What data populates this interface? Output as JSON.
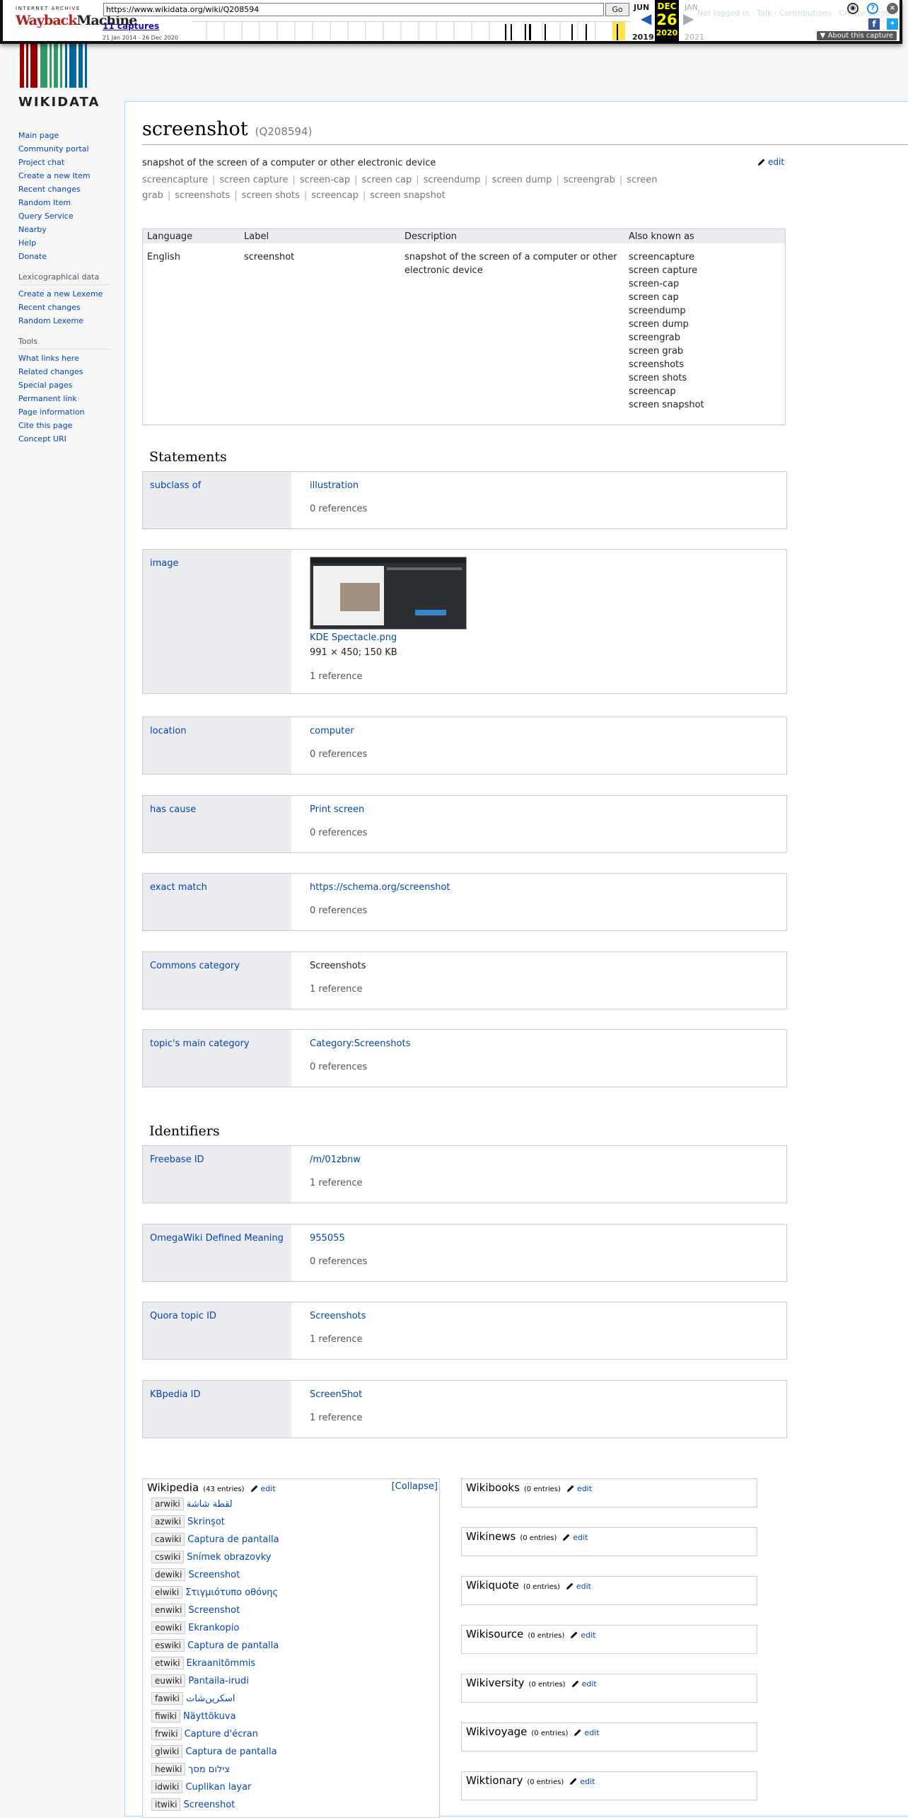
{
  "wayback": {
    "url": "https://www.wikidata.org/wiki/Q208594",
    "go_label": "Go",
    "captures": "11 captures",
    "range": "21 Jan 2014 - 26 Dec 2020",
    "prev_month": "JUN",
    "cur_month": "DEC",
    "cur_day": "26",
    "next_month": "JAN",
    "prev_year": "2019",
    "cur_year": "2020",
    "next_year": "2021",
    "about": "About this capture",
    "logo_top": "INTERNET ARCHIVE",
    "logo_main_a": "Wayback",
    "logo_main_b": "Machine"
  },
  "header": {
    "wordmark": "WIKIDATA",
    "ghost_links": [
      "Not logged in",
      "Talk",
      "Contributions",
      "Create account"
    ]
  },
  "sidebar": {
    "main": [
      "Main page",
      "Community portal",
      "Project chat",
      "Create a new Item",
      "Recent changes",
      "Random Item",
      "Query Service",
      "Nearby",
      "Help",
      "Donate"
    ],
    "lex_heading": "Lexicographical data",
    "lex": [
      "Create a new Lexeme",
      "Recent changes",
      "Random Lexeme"
    ],
    "tools_heading": "Tools",
    "tools": [
      "What links here",
      "Related changes",
      "Special pages",
      "Permanent link",
      "Page information",
      "Cite this page",
      "Concept URI"
    ]
  },
  "item": {
    "label": "screenshot",
    "qid": "(Q208594)",
    "description": "snapshot of the screen of a computer or other electronic device",
    "edit": "edit",
    "aliases": [
      "screencapture",
      "screen capture",
      "screen-cap",
      "screen cap",
      "screendump",
      "screen dump",
      "screengrab",
      "screen grab",
      "screenshots",
      "screen shots",
      "screencap",
      "screen snapshot"
    ]
  },
  "terms": {
    "headers": [
      "Language",
      "Label",
      "Description",
      "Also known as"
    ],
    "language": "English",
    "label": "screenshot",
    "description": "snapshot of the screen of a computer or other electronic device"
  },
  "statements_heading": "Statements",
  "statements": [
    {
      "property": "subclass of",
      "value": "illustration",
      "refs": "0 references"
    },
    {
      "property": "image",
      "value": "KDE Spectacle.png",
      "meta": "991 × 450; 150 KB",
      "refs": "1 reference"
    },
    {
      "property": "location",
      "value": "computer",
      "refs": "0 references"
    },
    {
      "property": "has cause",
      "value": "Print screen",
      "refs": "0 references"
    },
    {
      "property": "exact match",
      "value": "https://schema.org/screenshot",
      "refs": "0 references"
    },
    {
      "property": "Commons category",
      "value": "Screenshots",
      "refs": "1 reference"
    },
    {
      "property": "topic's main category",
      "value": "Category:Screenshots",
      "refs": "0 references"
    }
  ],
  "identifiers_heading": "Identifiers",
  "identifiers": [
    {
      "property": "Freebase ID",
      "value": "/m/01zbnw",
      "refs": "1 reference"
    },
    {
      "property": "OmegaWiki Defined Meaning",
      "value": "955055",
      "refs": "0 references"
    },
    {
      "property": "Quora topic ID",
      "value": "Screenshots",
      "refs": "1 reference"
    },
    {
      "property": "KBpedia ID",
      "value": "ScreenShot",
      "refs": "1 reference"
    }
  ],
  "wikipedia": {
    "title": "Wikipedia",
    "count": "(43 entries)",
    "edit": "edit",
    "collapse": "[Collapse]",
    "entries": [
      {
        "code": "arwiki",
        "title": "لقطة شاشة"
      },
      {
        "code": "azwiki",
        "title": "Skrinşot"
      },
      {
        "code": "cawiki",
        "title": "Captura de pantalla"
      },
      {
        "code": "cswiki",
        "title": "Snímek obrazovky"
      },
      {
        "code": "dewiki",
        "title": "Screenshot"
      },
      {
        "code": "elwiki",
        "title": "Στιγμιότυπο οθόνης"
      },
      {
        "code": "enwiki",
        "title": "Screenshot"
      },
      {
        "code": "eowiki",
        "title": "Ekrankopio"
      },
      {
        "code": "eswiki",
        "title": "Captura de pantalla"
      },
      {
        "code": "etwiki",
        "title": "Ekraanitõmmis"
      },
      {
        "code": "euwiki",
        "title": "Pantaila-irudi"
      },
      {
        "code": "fawiki",
        "title": "اسکرین‌شات"
      },
      {
        "code": "fiwiki",
        "title": "Näyttökuva"
      },
      {
        "code": "frwiki",
        "title": "Capture d'écran"
      },
      {
        "code": "glwiki",
        "title": "Captura de pantalla"
      },
      {
        "code": "hewiki",
        "title": "צילום מסך"
      },
      {
        "code": "idwiki",
        "title": "Cuplikan layar"
      },
      {
        "code": "itwiki",
        "title": "Screenshot"
      }
    ]
  },
  "sister": [
    {
      "name": "Wikibooks",
      "count": "(0 entries)",
      "edit": "edit"
    },
    {
      "name": "Wikinews",
      "count": "(0 entries)",
      "edit": "edit"
    },
    {
      "name": "Wikiquote",
      "count": "(0 entries)",
      "edit": "edit"
    },
    {
      "name": "Wikisource",
      "count": "(0 entries)",
      "edit": "edit"
    },
    {
      "name": "Wikiversity",
      "count": "(0 entries)",
      "edit": "edit"
    },
    {
      "name": "Wikivoyage",
      "count": "(0 entries)",
      "edit": "edit"
    },
    {
      "name": "Wiktionary",
      "count": "(0 entries)",
      "edit": "edit"
    }
  ]
}
